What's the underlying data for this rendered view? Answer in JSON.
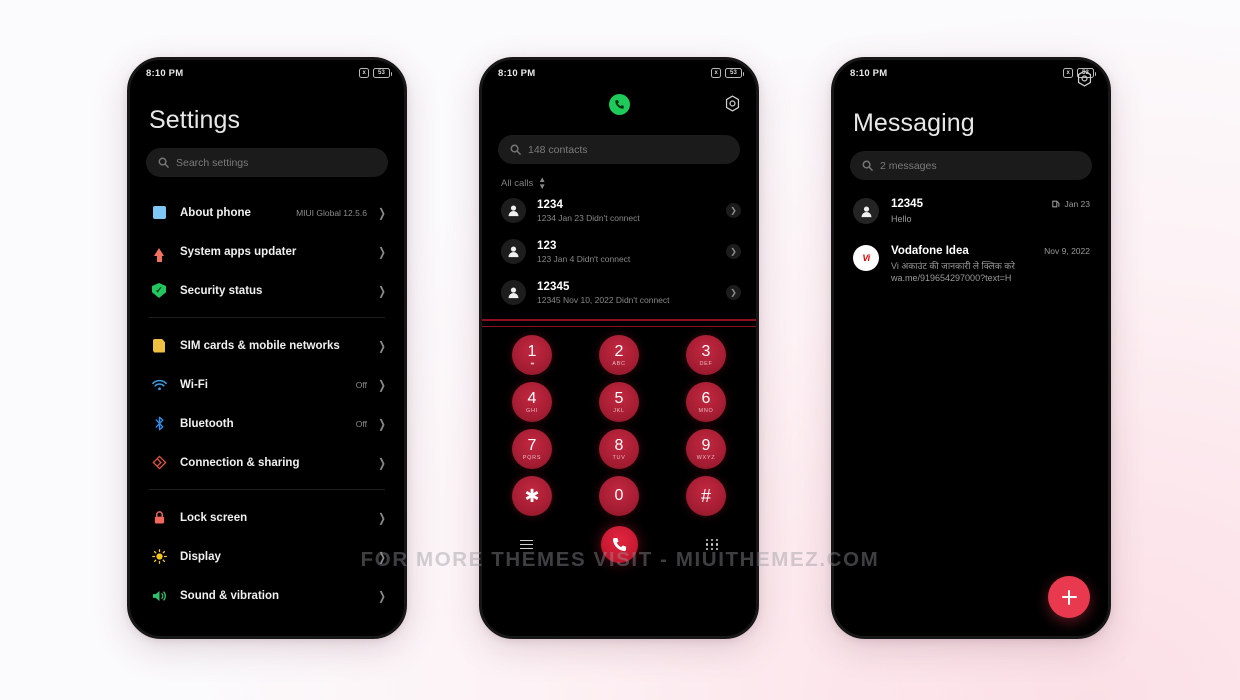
{
  "watermark": "FOR MORE THEMES VISIT - MIUITHEMEZ.COM",
  "statusbar": {
    "time": "8:10 PM",
    "mute_icon": "x",
    "battery": "53"
  },
  "settings": {
    "title": "Settings",
    "search_placeholder": "Search settings",
    "search_icon": "search-icon",
    "groups": [
      {
        "items": [
          {
            "label": "About phone",
            "value": "MIUI Global 12.5.6",
            "icon": "about-phone-icon"
          },
          {
            "label": "System apps updater",
            "value": "",
            "icon": "up-arrow-icon"
          },
          {
            "label": "Security status",
            "value": "",
            "icon": "shield-check-icon"
          }
        ]
      },
      {
        "items": [
          {
            "label": "SIM cards & mobile networks",
            "value": "",
            "icon": "sim-card-icon"
          },
          {
            "label": "Wi-Fi",
            "value": "Off",
            "icon": "wifi-icon"
          },
          {
            "label": "Bluetooth",
            "value": "Off",
            "icon": "bluetooth-icon"
          },
          {
            "label": "Connection & sharing",
            "value": "",
            "icon": "connection-sharing-icon"
          }
        ]
      },
      {
        "items": [
          {
            "label": "Lock screen",
            "value": "",
            "icon": "lock-icon"
          },
          {
            "label": "Display",
            "value": "",
            "icon": "brightness-icon"
          },
          {
            "label": "Sound & vibration",
            "value": "",
            "icon": "speaker-icon"
          }
        ]
      }
    ]
  },
  "dialer": {
    "avatar_icon": "phone-handset-icon",
    "settings_icon": "gear-icon",
    "search_placeholder": "148 contacts",
    "filter_label": "All calls",
    "calls": [
      {
        "name": "1234",
        "detail": "1234  Jan 23 Didn't connect"
      },
      {
        "name": "123",
        "detail": "123  Jan 4 Didn't connect"
      },
      {
        "name": "12345",
        "detail": "12345  Nov 10, 2022 Didn't connect"
      }
    ],
    "keypad": [
      [
        {
          "digit": "1",
          "letters": "••"
        },
        {
          "digit": "2",
          "letters": "ABC"
        },
        {
          "digit": "3",
          "letters": "DEF"
        }
      ],
      [
        {
          "digit": "4",
          "letters": "GHI"
        },
        {
          "digit": "5",
          "letters": "JKL"
        },
        {
          "digit": "6",
          "letters": "MNO"
        }
      ],
      [
        {
          "digit": "7",
          "letters": "PQRS"
        },
        {
          "digit": "8",
          "letters": "TUV"
        },
        {
          "digit": "9",
          "letters": "WXYZ"
        }
      ],
      [
        {
          "digit": "✱",
          "letters": ""
        },
        {
          "digit": "0",
          "letters": "+"
        },
        {
          "digit": "#",
          "letters": ""
        }
      ]
    ],
    "bottom": {
      "menu_icon": "hamburger-menu-icon",
      "call_icon": "call-button-icon",
      "dialpad_icon": "dialpad-icon"
    }
  },
  "messaging": {
    "title": "Messaging",
    "settings_icon": "gear-icon",
    "search_placeholder": "2 messages",
    "threads": [
      {
        "name": "12345",
        "snippet": "Hello",
        "date": "Jan 23",
        "avatar": "person-icon",
        "status_icon": "sent-icon"
      },
      {
        "name": "Vodafone Idea",
        "snippet": "Vi अकाउंट की जानकारी ले क्लिक करे wa.me/919654297000?text=H",
        "date": "Nov 9, 2022",
        "avatar": "vi-logo",
        "avatar_text": "Vi"
      }
    ],
    "fab_icon": "plus-icon"
  }
}
